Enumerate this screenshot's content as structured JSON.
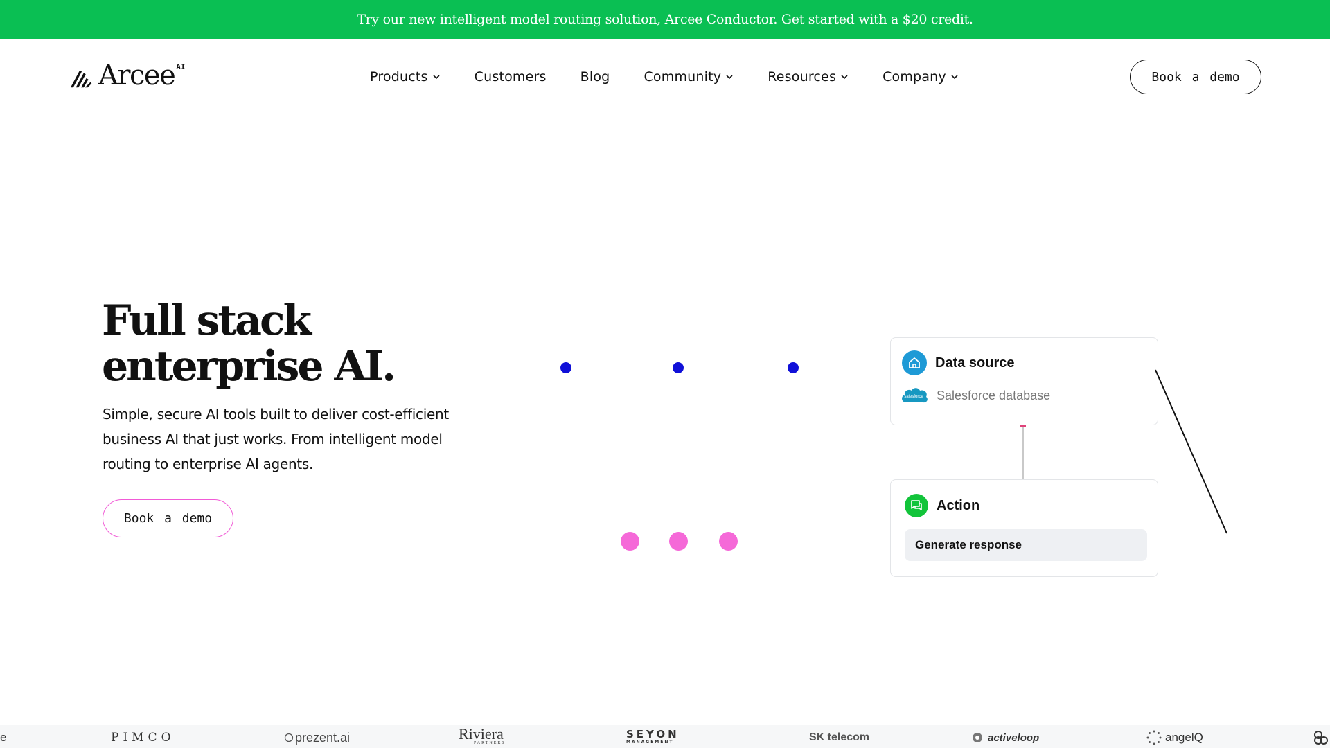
{
  "announcement": {
    "text": "Try our new intelligent model routing solution, Arcee Conductor. Get started with a $20 credit."
  },
  "header": {
    "logo_text": "Arcee",
    "logo_superscript": "AI",
    "nav": [
      {
        "label": "Products",
        "has_dropdown": true
      },
      {
        "label": "Customers",
        "has_dropdown": false
      },
      {
        "label": "Blog",
        "has_dropdown": false
      },
      {
        "label": "Community",
        "has_dropdown": true
      },
      {
        "label": "Resources",
        "has_dropdown": true
      },
      {
        "label": "Company",
        "has_dropdown": true
      }
    ],
    "cta_label": "Book a demo"
  },
  "hero": {
    "title_line1": "Full stack",
    "title_line2": "enterprise AI.",
    "subtitle": "Simple, secure AI tools built to deliver cost-efficient business AI that just works. From intelligent model routing to enterprise AI agents.",
    "cta_label": "Book a demo"
  },
  "diagram": {
    "data_source": {
      "title": "Data source",
      "icon": "home-icon",
      "source_label": "Salesforce database",
      "source_logo_text": "salesforce"
    },
    "action": {
      "title": "Action",
      "icon": "chat-icon",
      "step_label": "Generate response"
    },
    "colors": {
      "blue_dot": "#1010d8",
      "pink_dot": "#f569d8",
      "data_source_icon": "#1e9ad6",
      "action_icon": "#12c43a"
    }
  },
  "logos": {
    "edge_left": "e",
    "pimco": "PIMCO",
    "prezent": "prezent.ai",
    "riviera": "Riviera",
    "riviera_sub": "PARTNERS",
    "seyon": "SEYON",
    "seyon_sub": "MANAGEMENT",
    "sk": "SK telecom",
    "activeloop": "activeloop",
    "angelq": "angelQ"
  },
  "colors": {
    "brand_green": "#0abf53",
    "hero_button_border": "#f15ad6"
  }
}
